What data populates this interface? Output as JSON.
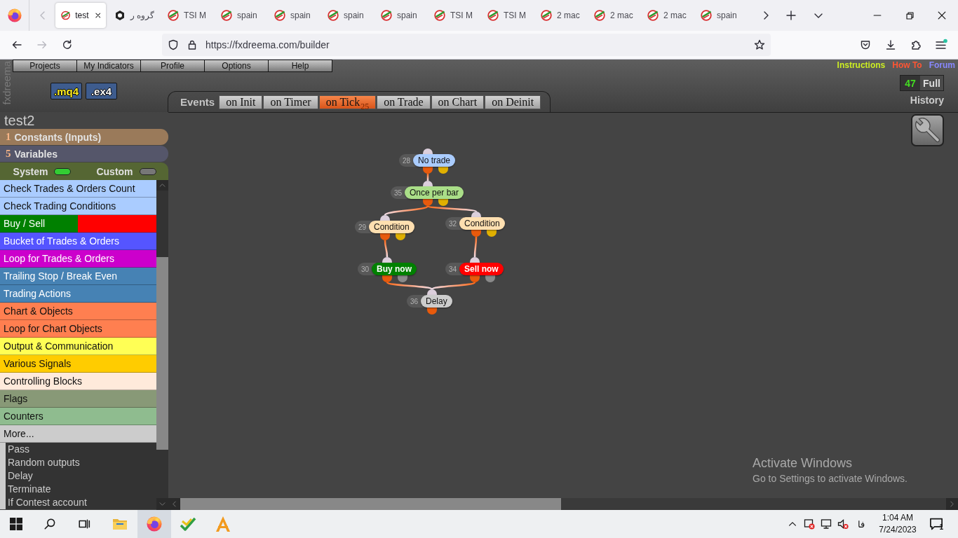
{
  "browser": {
    "tabs": [
      {
        "title": "test",
        "selected": true,
        "kind": "swoosh"
      },
      {
        "title": "گروه ر",
        "selected": false,
        "kind": "hexagon"
      },
      {
        "title": "TSI M",
        "selected": false,
        "kind": "swoosh"
      },
      {
        "title": "spain",
        "selected": false,
        "kind": "swoosh"
      },
      {
        "title": "spain",
        "selected": false,
        "kind": "swoosh"
      },
      {
        "title": "spain",
        "selected": false,
        "kind": "swoosh"
      },
      {
        "title": "spain",
        "selected": false,
        "kind": "swoosh"
      },
      {
        "title": "TSI M",
        "selected": false,
        "kind": "swoosh"
      },
      {
        "title": "TSI M",
        "selected": false,
        "kind": "swoosh"
      },
      {
        "title": "2 mac",
        "selected": false,
        "kind": "swoosh"
      },
      {
        "title": "2 mac",
        "selected": false,
        "kind": "swoosh"
      },
      {
        "title": "2 mac",
        "selected": false,
        "kind": "swoosh"
      },
      {
        "title": "spain",
        "selected": false,
        "kind": "swoosh"
      }
    ],
    "scroll_buttons": [
      {
        "kind": "left",
        "disabled": true
      },
      {
        "kind": "right",
        "disabled": false
      }
    ],
    "navigation": [
      {
        "kind": "back",
        "disabled": false
      },
      {
        "kind": "forward",
        "disabled": true
      },
      {
        "kind": "reload",
        "disabled": false
      }
    ],
    "url": "https://fxdreema.com/builder",
    "menu_update": true
  },
  "app": {
    "logo": "fxdreema",
    "menu": [
      "Projects",
      "My Indicators",
      "Profile",
      "Options",
      "Help"
    ],
    "build_buttons": [
      {
        "label": ".mq4",
        "kind": "source"
      },
      {
        "label": ".ex4",
        "kind": "compiled"
      }
    ],
    "links": [
      {
        "label": "Instructions",
        "color": "#ccee22"
      },
      {
        "label": "How To",
        "color": "#ff5533"
      },
      {
        "label": "Forum",
        "color": "#8888ff"
      }
    ],
    "counter": {
      "count": "47",
      "plan": "Full"
    },
    "history": "History",
    "events": {
      "label": "Events",
      "tabs": [
        {
          "label": "on Init",
          "selected": false
        },
        {
          "label": "on Timer",
          "selected": false
        },
        {
          "label": "on Tick",
          "selected": true,
          "count": "25"
        },
        {
          "label": "on Trade",
          "selected": false
        },
        {
          "label": "on Chart",
          "selected": false
        },
        {
          "label": "on Deinit",
          "selected": false
        }
      ]
    },
    "project": "test2",
    "sections": [
      {
        "count": "1",
        "label": "Constants (Inputs)",
        "color": "#9a7a5a"
      },
      {
        "count": "5",
        "label": "Variables",
        "color": "#55566a"
      }
    ],
    "filters": [
      {
        "label": "System",
        "on": true
      },
      {
        "label": "Custom",
        "on": false
      }
    ],
    "categories": [
      {
        "label": "Check Trades & Orders Count",
        "color": "#aaccff"
      },
      {
        "label": "Check Trading Conditions",
        "color": "#aaccff"
      },
      {
        "label": "Buy / Sell",
        "color": "#008000",
        "second_half": {
          "color": "#ff0000"
        }
      },
      {
        "label": "Bucket of Trades & Orders",
        "color": "#5555ff"
      },
      {
        "label": "Loop for Trades & Orders",
        "color": "#cc00cc"
      },
      {
        "label": "Trailing Stop / Break Even",
        "color": "#4682b4"
      },
      {
        "label": "Trading Actions",
        "color": "#4682b4"
      },
      {
        "label": "Chart & Objects",
        "color": "#ff7f50"
      },
      {
        "label": "Loop for Chart Objects",
        "color": "#ff7f50"
      },
      {
        "label": "Output & Communication",
        "color": "#ffff55"
      },
      {
        "label": "Various Signals",
        "color": "#ffcc00"
      },
      {
        "label": "Controlling Blocks",
        "color": "#ffeadb"
      },
      {
        "label": "Flags",
        "color": "#889977"
      },
      {
        "label": "Counters",
        "color": "#8fbc8f"
      },
      {
        "label": "More...",
        "color": "#cccccc",
        "children": [
          {
            "label": "Pass"
          },
          {
            "label": "Random outputs"
          },
          {
            "label": "Delay"
          },
          {
            "label": "Terminate"
          },
          {
            "label": "If Contest account"
          }
        ]
      }
    ],
    "nodes": [
      {
        "number": "28",
        "label": "No trade",
        "color": "#aaccff",
        "kind": "filter"
      },
      {
        "number": "35",
        "label": "Once per bar",
        "color": "#aade88",
        "kind": "filter"
      },
      {
        "number": "29",
        "label": "Condition",
        "color": "#ffdfb0",
        "kind": "filter"
      },
      {
        "number": "32",
        "label": "Condition",
        "color": "#ffdfb0",
        "kind": "filter"
      },
      {
        "number": "30",
        "label": "Buy now",
        "color": "#008000",
        "kind": "trade"
      },
      {
        "number": "34",
        "label": "Sell now",
        "color": "#ff0000",
        "kind": "trade"
      },
      {
        "number": "36",
        "label": "Delay",
        "color": "#cccccc",
        "kind": "action"
      }
    ]
  },
  "activation_notice": {
    "title": "Activate Windows",
    "text": "Go to Settings to activate Windows."
  },
  "taskbar": {
    "language": "فا",
    "time": "1:04 AM",
    "date": "7/24/2023",
    "notifications": "1"
  }
}
